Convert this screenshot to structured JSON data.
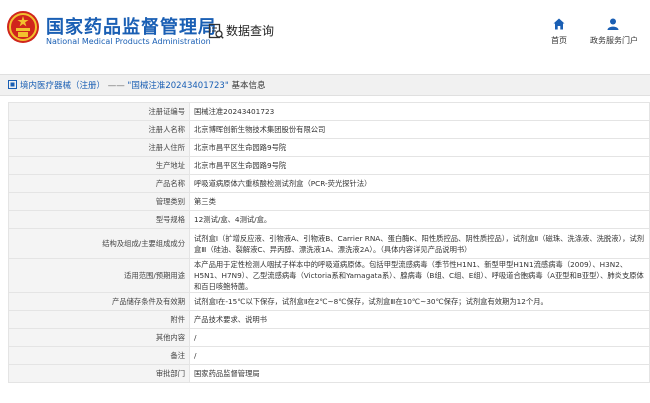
{
  "header": {
    "site_name_cn": "国家药品监督管理局",
    "site_name_en": "National Medical Products Administration",
    "db_query_label": "数据查询",
    "nav": {
      "home_label": "首页",
      "gov_service_label": "政务服务门户"
    }
  },
  "breadcrumb": {
    "category": "境内医疗器械（注册）",
    "separator": "——",
    "title": "\"国械注准20243401723\"",
    "suffix": "基本信息"
  },
  "details": [
    {
      "label": "注册证编号",
      "value": "国械注准20243401723"
    },
    {
      "label": "注册人名称",
      "value": "北京博晖创新生物技术集团股份有限公司"
    },
    {
      "label": "注册人住所",
      "value": "北京市昌平区生命园路9号院"
    },
    {
      "label": "生产地址",
      "value": "北京市昌平区生命园路9号院"
    },
    {
      "label": "产品名称",
      "value": "呼吸道病原体六重核酸检测试剂盒（PCR-荧光探针法）"
    },
    {
      "label": "管理类别",
      "value": "第三类"
    },
    {
      "label": "型号规格",
      "value": "12测试/盒、4测试/盒。"
    },
    {
      "label": "结构及组成/主要组成成分",
      "value": "试剂盒Ⅰ（扩增反应液、引物液A、引物液B、Carrier RNA、蛋白酶K、阳性质控品、阴性质控品），试剂盒Ⅱ（磁珠、洗涤液、洗脱液），试剂盒Ⅲ（硅油、裂解液C、异丙醇、漂洗液1A、漂洗液2A）。（具体内容详见产品说明书）"
    },
    {
      "label": "适用范围/预期用途",
      "value": "本产品用于定性检测人咽拭子样本中的呼吸道病原体。包括甲型流感病毒（季节性H1N1、新型甲型H1N1流感病毒（2009）、H3N2、H5N1、H7N9）、乙型流感病毒（Victoria系和Yamagata系）、腺病毒（B组、C组、E组）、呼吸道合胞病毒（A亚型和B亚型）、肺炎支原体和百日咳鲍特菌。"
    },
    {
      "label": "产品储存条件及有效期",
      "value": "试剂盒Ⅰ在-15℃以下保存，试剂盒Ⅱ在2℃~8℃保存，试剂盒Ⅲ在10℃~30℃保存；试剂盒有效期为12个月。"
    },
    {
      "label": "附件",
      "value": "产品技术要求、说明书"
    },
    {
      "label": "其他内容",
      "value": "/"
    },
    {
      "label": "备注",
      "value": "/"
    },
    {
      "label": "审批部门",
      "value": "国家药品监督管理局"
    }
  ],
  "colors": {
    "brand_blue": "#1a5fb4",
    "emblem_red": "#d0251c",
    "emblem_gold": "#f2c12e"
  }
}
